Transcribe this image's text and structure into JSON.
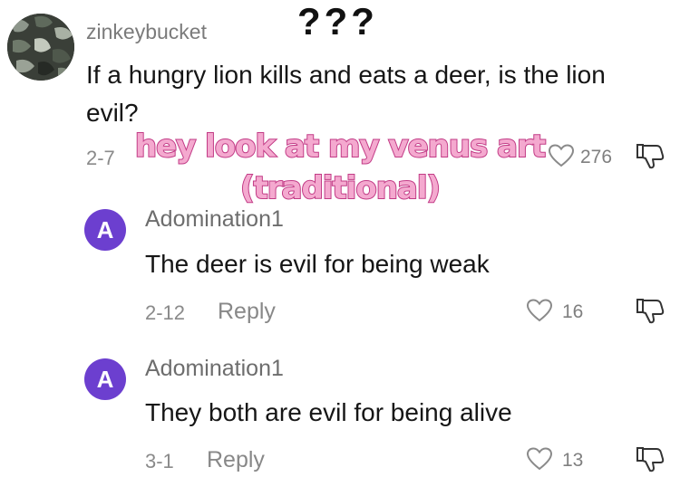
{
  "caption_top": "???",
  "overlay_caption": {
    "line1": "hey look at my venus art",
    "line2": "(traditional)"
  },
  "comment": {
    "username": "zinkeybucket",
    "text": "If a hungry lion kills and eats a deer, is the lion evil?",
    "date": "2-7",
    "likes": "276",
    "avatar_icon": "camo-pattern-avatar"
  },
  "replies": [
    {
      "avatar_letter": "A",
      "username": "Adomination1",
      "text": "The deer is evil for being weak",
      "date": "2-12",
      "reply_label": "Reply",
      "likes": "16"
    },
    {
      "avatar_letter": "A",
      "username": "Adomination1",
      "text": "They both are evil for being alive",
      "date": "3-1",
      "reply_label": "Reply",
      "likes": "13"
    }
  ],
  "colors": {
    "avatar_purple": "#6c3fcf",
    "overlay_fill": "#f4a9cf",
    "overlay_stroke": "#c23b86",
    "muted_text": "#8a8a8a"
  }
}
